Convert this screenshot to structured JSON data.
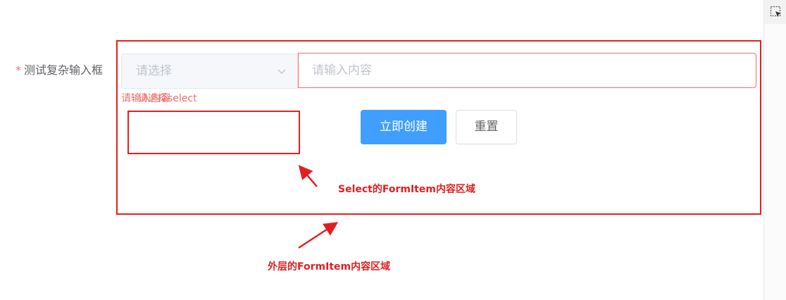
{
  "form": {
    "required_mark": "*",
    "label": "测试复杂输入框",
    "select": {
      "placeholder": "请选择"
    },
    "input": {
      "placeholder": "请输入内容",
      "value": ""
    },
    "errors": {
      "input_error": "请输入内容",
      "select_error": "请选择select"
    }
  },
  "actions": {
    "create_label": "立即创建",
    "reset_label": "重置"
  },
  "annotations": {
    "select_item_label": "Select的FormItem内容区域",
    "outer_item_label": "外层的FormItem内容区域"
  },
  "colors": {
    "primary": "#409eff",
    "error": "#f56c6c",
    "annotation_red": "#e02020",
    "placeholder": "#c0c4cc",
    "label_text": "#606266"
  },
  "icons": {
    "select_chevron": "chevron-down-icon",
    "inspector_tool": "element-picker-icon"
  }
}
